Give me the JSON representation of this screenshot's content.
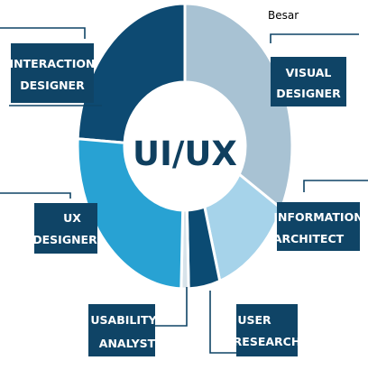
{
  "corner_label": "Besar",
  "center_title": "UI/UX",
  "segments": [
    {
      "label_lines": [
        "INTERACTION",
        "DESIGNER"
      ],
      "color": "#0d4a72"
    },
    {
      "label_lines": [
        "VISUAL",
        "DESIGNER"
      ],
      "color": "#a8c2d3"
    },
    {
      "label_lines": [
        "INFORMATION",
        "ARCHITECT"
      ],
      "color": "#a6d3ea"
    },
    {
      "label_lines": [
        "USER",
        "RESEARCH"
      ],
      "color": "#0b4b73"
    },
    {
      "label_lines": [
        "USABILITY",
        "ANALYST"
      ],
      "color": "#d7e3ea"
    },
    {
      "label_lines": [
        "UX",
        "DESIGNER"
      ],
      "color": "#28a2d3"
    }
  ],
  "colors": {
    "box": "#0f4466",
    "line": "#0f4466",
    "center_text": "#0f3f5f"
  }
}
